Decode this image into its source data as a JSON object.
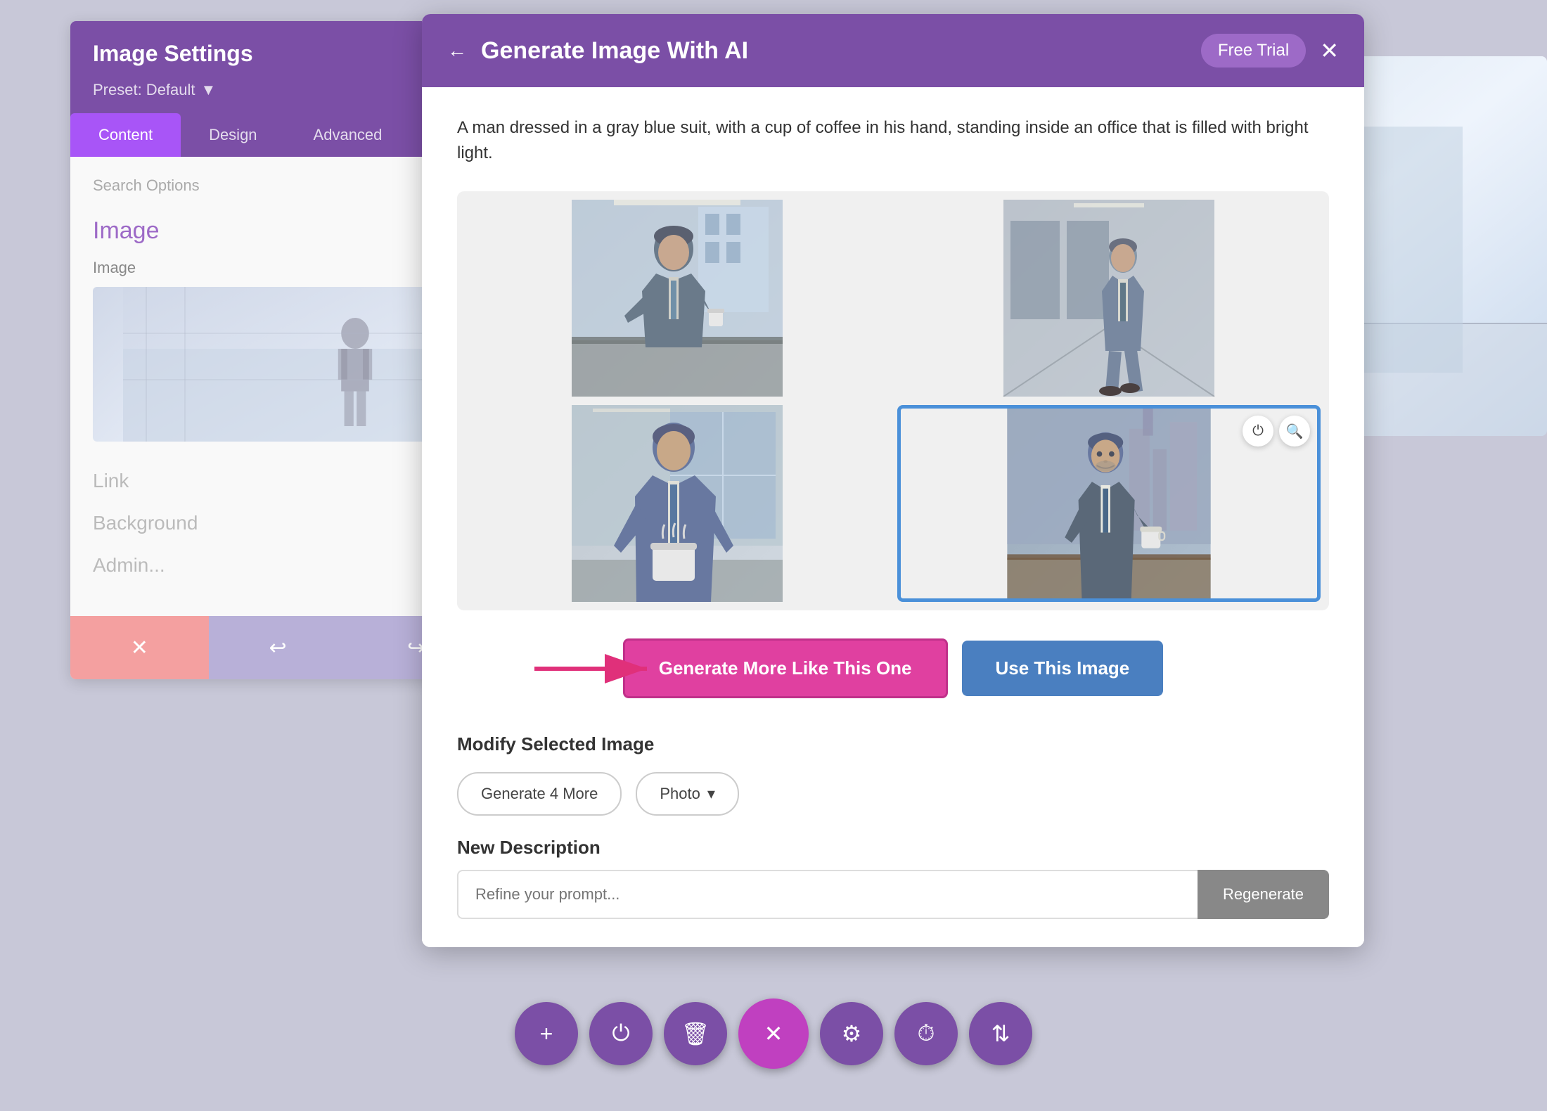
{
  "canvas": {
    "background_color": "#c8c8d8"
  },
  "left_panel": {
    "title": "Image Settings",
    "subtitle": "Preset: Default",
    "subtitle_arrow": "▼",
    "settings_icon": "⚙",
    "tabs": [
      {
        "label": "Content",
        "active": true
      },
      {
        "label": "Design",
        "active": false
      },
      {
        "label": "Advanced",
        "active": false
      }
    ],
    "search_placeholder": "Search Options",
    "section_image_title": "Image",
    "section_image_label": "Image",
    "section_link_label": "Link",
    "section_background_label": "Background",
    "section_admin_label": "Admin...",
    "footer_buttons": [
      {
        "label": "✕",
        "type": "cancel"
      },
      {
        "label": "↩",
        "type": "undo"
      },
      {
        "label": "↪",
        "type": "redo"
      }
    ]
  },
  "modal": {
    "title": "Generate Image With AI",
    "back_icon": "←",
    "free_trial_label": "Free Trial",
    "close_icon": "✕",
    "prompt_text": "A man dressed in a gray blue suit, with a cup of coffee in his hand, standing inside an office that is filled with bright light.",
    "images": [
      {
        "id": 1,
        "selected": false,
        "description": "Man in suit with coffee in office"
      },
      {
        "id": 2,
        "selected": false,
        "description": "Man in suit walking in corridor"
      },
      {
        "id": 3,
        "selected": false,
        "description": "Man in suit holding coffee cup close-up"
      },
      {
        "id": 4,
        "selected": true,
        "description": "Man in suit in modern office with city view"
      }
    ],
    "selected_image_overlays": [
      {
        "icon": "⏻",
        "label": "power-icon"
      },
      {
        "icon": "🔍",
        "label": "search-icon"
      }
    ],
    "generate_more_label": "Generate More Like This One",
    "use_image_label": "Use This Image",
    "modify_title": "Modify Selected Image",
    "generate_4more_label": "Generate 4 More",
    "photo_select_label": "Photo",
    "photo_select_arrow": "▾",
    "new_desc_title": "New Description",
    "new_desc_placeholder": "Refine your prompt...",
    "regenerate_label": "Regenerate"
  },
  "bottom_toolbar": {
    "buttons": [
      {
        "icon": "+",
        "name": "add"
      },
      {
        "icon": "⏻",
        "name": "power"
      },
      {
        "icon": "🗑",
        "name": "delete"
      },
      {
        "icon": "✕",
        "name": "close",
        "highlight": true
      },
      {
        "icon": "⚙",
        "name": "settings"
      },
      {
        "icon": "🕐",
        "name": "history"
      },
      {
        "icon": "⇅",
        "name": "sort"
      }
    ]
  },
  "colors": {
    "purple_primary": "#7b4fa6",
    "purple_light": "#a855f7",
    "purple_badge": "#9d6ac7",
    "pink_btn": "#e040a0",
    "blue_btn": "#4a7fc0",
    "blue_selected": "#4a90d9",
    "cancel_red": "#f4a0a0",
    "undo_purple": "#b8b0d8"
  }
}
